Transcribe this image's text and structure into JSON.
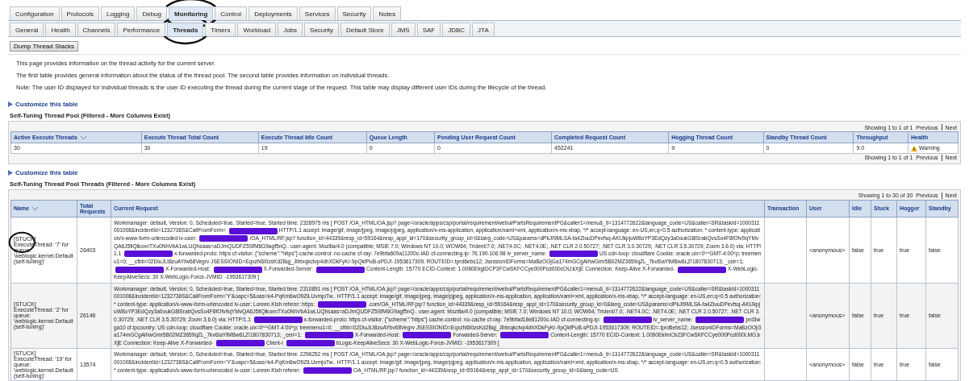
{
  "main_tabs": [
    {
      "label": "Configuration",
      "selected": false,
      "circled": false
    },
    {
      "label": "Protocols",
      "selected": false,
      "circled": false
    },
    {
      "label": "Logging",
      "selected": false,
      "circled": false
    },
    {
      "label": "Debug",
      "selected": false,
      "circled": false
    },
    {
      "label": "Monitoring",
      "selected": true,
      "circled": true
    },
    {
      "label": "Control",
      "selected": false,
      "circled": false
    },
    {
      "label": "Deployments",
      "selected": false,
      "circled": false
    },
    {
      "label": "Services",
      "selected": false,
      "circled": false
    },
    {
      "label": "Security",
      "selected": false,
      "circled": false
    },
    {
      "label": "Notes",
      "selected": false,
      "circled": false
    }
  ],
  "sub_tabs": [
    {
      "label": "General",
      "selected": false,
      "circled": false
    },
    {
      "label": "Health",
      "selected": false,
      "circled": false
    },
    {
      "label": "Channels",
      "selected": false,
      "circled": false
    },
    {
      "label": "Performance",
      "selected": false,
      "circled": false
    },
    {
      "label": "Threads",
      "selected": true,
      "circled": true
    },
    {
      "label": "Timers",
      "selected": false,
      "circled": false
    },
    {
      "label": "Workload",
      "selected": false,
      "circled": false
    },
    {
      "label": "Jobs",
      "selected": false,
      "circled": false
    },
    {
      "label": "Security",
      "selected": false,
      "circled": false
    },
    {
      "label": "Default Store",
      "selected": false,
      "circled": false
    },
    {
      "label": "JMS",
      "selected": false,
      "circled": false
    },
    {
      "label": "SAF",
      "selected": false,
      "circled": false
    },
    {
      "label": "JDBC",
      "selected": false,
      "circled": false
    },
    {
      "label": "JTA",
      "selected": false,
      "circled": false
    }
  ],
  "action_button": "Dump Thread Stacks",
  "paragraphs": [
    "This page provides information on the thread activity for the current server.",
    "The first table provides general information about the status of the thread pool. The second table provides information on individual threads.",
    "Note: The user ID displayed for individual threads is the user ID executing the thread during the current stage of the request. This table may display different user IDs during the lifecycle of the thread."
  ],
  "pool_table": {
    "customize_link": "Customize this table",
    "title": "Self-Tuning Thread Pool (Filtered - More Columns Exist)",
    "pagination_top": {
      "showing": "Showing 1 to 1 of 1",
      "previous": "Previous",
      "next": "Next"
    },
    "columns": [
      {
        "label": "Active Execute Threads",
        "sortable": true
      },
      {
        "label": "Execute Thread Total Count",
        "sortable": false
      },
      {
        "label": "Execute Thread Idle Count",
        "sortable": false
      },
      {
        "label": "Queue Length",
        "sortable": false
      },
      {
        "label": "Pending User Request Count",
        "sortable": false
      },
      {
        "label": "Completed Request Count",
        "sortable": false
      },
      {
        "label": "Hogging Thread Count",
        "sortable": false
      },
      {
        "label": "Standby Thread Count",
        "sortable": false
      },
      {
        "label": "Throughput",
        "sortable": false
      },
      {
        "label": "Health",
        "sortable": false
      }
    ],
    "rows": [
      {
        "cells": [
          {
            "kind": "text",
            "text": "30"
          },
          {
            "kind": "text",
            "text": "30"
          },
          {
            "kind": "text",
            "text": "19"
          },
          {
            "kind": "text",
            "text": "0"
          },
          {
            "kind": "text",
            "text": "0"
          },
          {
            "kind": "text",
            "text": "452241"
          },
          {
            "kind": "text",
            "text": "9"
          },
          {
            "kind": "text",
            "text": "0"
          },
          {
            "kind": "text",
            "text": "9.0"
          },
          {
            "kind": "warning",
            "text": "Warning"
          }
        ]
      }
    ],
    "pagination_bottom": {
      "showing": "Showing 1 to 1 of 1",
      "previous": "Previous",
      "next": "Next"
    }
  },
  "threads_table": {
    "customize_link": "Customize this table",
    "title": "Self-Tuning Thread Pool Threads (Filtered - More Columns Exist)",
    "pagination_top": {
      "showing": "Showing 1 to 30 of 30",
      "previous": "Previous",
      "next": "Next"
    },
    "columns": [
      {
        "label": "Name",
        "sortable": true
      },
      {
        "label": "Total Requests",
        "sortable": false
      },
      {
        "label": "Current Request",
        "sortable": false
      },
      {
        "label": "Transaction",
        "sortable": false
      },
      {
        "label": "User",
        "sortable": false
      },
      {
        "label": "Idle",
        "sortable": false
      },
      {
        "label": "Stuck",
        "sortable": false
      },
      {
        "label": "Hogger",
        "sortable": false
      },
      {
        "label": "Standby",
        "sortable": false
      }
    ],
    "rows": [
      {
        "name": "[STUCK] ExecuteThread: '7' for queue: 'weblogic.kernel.Default (self-tuning)'",
        "circled": true,
        "total": "26403",
        "request": [
          {
            "kind": "text",
            "text": "Workmanager: default, Version: 0, Scheduled=true, Started=true, Started time: 2328975 ms [ POST /OA_HTML/OA.jsp? page=/oracle/apps/csp/portal/requirement/webui/PartsRequirementPG&caller1=menu&_ti=1314772622&language_code=US&caller=SR&taskId=1000311001008&incidentId=1232738S&CallFromForm="
          },
          {
            "kind": "redaction"
          },
          {
            "kind": "text",
            "text": "HTTP/1.1 accept: image/gif, image/jpeg, image/pjpeg, application/x-ms-application, application/xaml+xml, application/x-ms-xbap, */* accept-language: en-US,en;q=0.5 authorization: * content-type: application/x-www-form-urlencoded iv-user:"
          },
          {
            "kind": "redaction"
          },
          {
            "kind": "text",
            "text": "/OA_HTML/RF.jsp? function_id=44339&resp_id=59164&resp_appl_id=170&security_group_id=0&lang_code=US&params=dPkJI9MLSA-fa4ZiuuDPevfsq-AKIJkpjuW8oYP3EdQzy3a0oukG8lSrabQvsSo4F8fOfv9qYMvQA6J5fiQlkoxnTXu0NhVbA1wLUQhsaas=aDJmQUDFZ5SfM6G9agf5nQ.. user-agent: Mozilla/4.0 (compatible; MSIE 7.0; Windows NT 10.0; WOW64; Trident/7.0; .NET4.0C; .NET4.0E; .NET CLR 2.0.50727; .NET CLR 3.0.30729; .NET CLR 3.5.30729; Zoom 3.6.0) via: HTTP/1.1"
          },
          {
            "kind": "redaction"
          },
          {
            "kind": "text",
            "text": "x-forwarded-proto: https cf-visitor: {\"scheme\":\"https\"} cache-control: no-cache cf-ray: 7e9bfa609a11200c-IAD cf-connecting-ip: 76.190.106.98 iv_server_name:"
          },
          {
            "kind": "redaction"
          },
          {
            "kind": "text",
            "text": "US cdn-loop: cloudflare Cookie: oracle.uix=0^^GMT-4:00^p; treemenu1=0; __cfbb=02DiuJLt8zuAYbv68Vegrv JSESSIONID=EqxzN6l0zsKd2Bqj_Jlhtxqkctvp4dhXDkFyKr-9pQkfPuB-sPDJ!-1953617309; ROUTEID=.tprd6ebs12; JsessionIDForms=MaBzOOjGa174mGCgAihwGmr5B02MZ3659qZL_7kv6IaYtMBw6LZ!1807830713; _ceir=1;"
          },
          {
            "kind": "redaction"
          },
          {
            "kind": "text",
            "text": "X-Forwarded-Host:"
          },
          {
            "kind": "redaction"
          },
          {
            "kind": "text",
            "text": "X-Forwarded-Server:"
          },
          {
            "kind": "redaction"
          },
          {
            "kind": "text",
            "text": "Content-Length: 15770 ECID-Context: 1.0060EkgIDCP3FCwSKFCCye000Pcd000cOU;kXjE Connection: Keep-Alive X-Forwarded-"
          },
          {
            "kind": "redaction"
          },
          {
            "kind": "text",
            "text": "X-WebLogic-KeepAliveSecs: 30 X-WebLogic-Force-JVMID: -1953617309 ]"
          }
        ],
        "transaction": "",
        "user": "<anonymous>",
        "idle": "false",
        "stuck": "true",
        "hogger": "true",
        "standby": "false"
      },
      {
        "name": "[STUCK] ExecuteThread: '2' for queue: 'weblogic.kernel.Default (self-tuning)'",
        "circled": false,
        "total": "26146",
        "request": [
          {
            "kind": "text",
            "text": "Workmanager: default, Version: 0, Scheduled=true, Started=true, Started time: 2310891 ms [ POST /OA_HTML/OA.jsp? page=/oracle/apps/csp/portal/requirement/webui/PartsRequirementPG&caller1=menu&_ti=1314772622&language_code=US&caller=SR&taskId=1000311001008&incidentId=1232738S&CallFromForm='Y'&oapc=5&oas=k4-PqKm6wO9ZlLUvmjoTw.. HTTP/1.1 accept: image/gif, image/jpeg, image/pjpeg, application/x-ms-application, application/xaml+xml, application/x-ms-xbap, */* accept-language: en-US,en;q=0.5 authorization: * content-type: application/x-www-form-urlencoded iv-user: Loreen.Kish referer: https:"
          },
          {
            "kind": "redaction"
          },
          {
            "kind": "text",
            "text": ".com/OA_HTML/RF.jsp? function_id=44339&resp_id=59164&resp_appl_id=170&security_group_id=0&lang_code=US&params=dPkJI9MLSA-fa4ZiuuDPevfsq-AKIJkpjuW8oYP3EdQzy3a0oukG8lSrabQvsSo4F8fOfv9qYMvQA6J5fiQlkoxnTXu0NhVbA1wLUQhsaas=aDJmQUDFZ5SfM6G9agf5nQ.. user-agent: Mozilla/4.0 (compatible; MSIE 7.0; Windows NT 10.0; WOW64; Trident/7.0; .NET4.0C; .NET4.0E; .NET CLR 2.0.50727; .NET CLR 3.0.30729; .NET CLR 3.5.30729; Zoom 3.6.0) via: HTTP/1.1"
          },
          {
            "kind": "redaction"
          },
          {
            "kind": "text",
            "text": "x-forwarded-proto: https cf-visitor: {\"scheme\":\"https\"} cache-control: no-cache cf-ray: 7e9bfad18e81200c-IAD cf-connecting-ip:"
          },
          {
            "kind": "redaction"
          },
          {
            "kind": "text",
            "text": "iv_server_name:"
          },
          {
            "kind": "redaction"
          },
          {
            "kind": "text",
            "text": "prd3wga10 cf-ipcountry: US cdn-loop: cloudflare Cookie: oracle.uix=0^^GMT-4:00^p; treemenu1=0; __cfbb=02DiuJLt8zuAYbv68Vegrv JSESSIONID=EqxzN6l0zsKd2Bqj_Jlhtxqkctvp4dhXDkFyKr-9pQkfPuB-sPDJ!-1953617309; ROUTEID=.tprd6ebs12; JsessionIDForms=MaBzOOjGa174mGCgAihwGmr5B02MZ3659qZL_7kv6IaYtMBw6LZ!1807830713; _ceir=1;"
          },
          {
            "kind": "redaction"
          },
          {
            "kind": "text",
            "text": "X-Forwarded-Host:"
          },
          {
            "kind": "redaction"
          },
          {
            "kind": "text",
            "text": "Forwarded-Server:"
          },
          {
            "kind": "redaction"
          },
          {
            "kind": "text",
            "text": "Content-Length: 15770 ECID-Context: 1.0060EkhnCb23FCwSKFCCye000Pcd000LMG;kXjE Connection: Keep-Alive X-Forwarded-"
          },
          {
            "kind": "redaction"
          },
          {
            "kind": "text",
            "text": "Client-I"
          },
          {
            "kind": "redaction"
          },
          {
            "kind": "text",
            "text": "bLogic-KeepAliveSecs: 30 X-WebLogic-Force-JVMID: -1953617309 ]"
          }
        ],
        "transaction": "",
        "user": "<anonymous>",
        "idle": "false",
        "stuck": "true",
        "hogger": "true",
        "standby": "false"
      },
      {
        "name": "[STUCK] ExecuteThread: '19' for queue: 'weblogic.kernel.Default (self-tuning)'",
        "circled": false,
        "total": "13574",
        "request": [
          {
            "kind": "text",
            "text": "Workmanager: default, Version: 0, Scheduled=true, Started=true, Started time: 2296252 ms [ POST /OA_HTML/OA.jsp? page=/oracle/apps/csp/portal/requirement/webui/PartsRequirementPG&caller1=menu&_ti=1314772622&language_code=US&caller=SR&taskId=1000311001008&incidentId=1232738S&CallFromForm='Y'&oapc=5&oas=k4-PqKm6wO9ZlLUvmjoTw.. HTTP/1.1 accept: image/gif, image/jpeg, image/pjpeg, application/x-ms-application, application/xaml+xml, application/x-ms-xbap, */* accept-language: en-US,en;q=0.5 authorization: * content-type: application/x-www-form-urlencoded iv-user: Loreen.Kish referer:"
          },
          {
            "kind": "redaction"
          },
          {
            "kind": "text",
            "text": "OA_HTML/RF.jsp? function_id=44339&resp_id=59164&resp_appl_id=170&security_group_id=0&lang_code=US"
          }
        ],
        "transaction": "",
        "user": "<anonymous>",
        "idle": "false",
        "stuck": "true",
        "hogger": "true",
        "standby": "false"
      }
    ]
  }
}
